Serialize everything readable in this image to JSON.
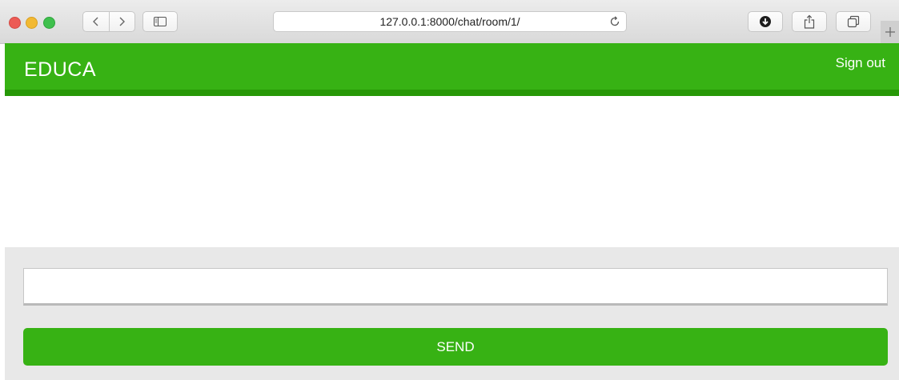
{
  "browser": {
    "url": "127.0.0.1:8000/chat/room/1/",
    "icons": [
      "back-icon",
      "forward-icon",
      "sidebar-icon",
      "reload-icon",
      "download-icon",
      "share-icon",
      "tabs-icon",
      "new-tab-icon"
    ]
  },
  "header": {
    "brand": "EDUCA",
    "signout_label": "Sign out"
  },
  "chat": {
    "input_value": "",
    "send_label": "SEND"
  },
  "colors": {
    "accent": "#37b214",
    "accent_dark": "#279807",
    "form_bg": "#e8e8e8"
  }
}
